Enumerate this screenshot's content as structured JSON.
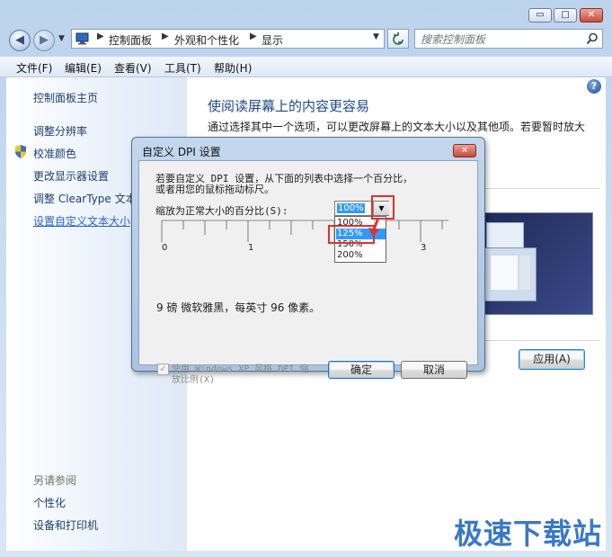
{
  "window": {
    "caption_buttons": {
      "minimize": "▭",
      "maximize": "□",
      "close": "✕"
    }
  },
  "nav": {
    "back_icon": "back-arrow-icon",
    "forward_icon": "forward-arrow-icon",
    "breadcrumb": [
      "控制面板",
      "外观和个性化",
      "显示"
    ],
    "search_placeholder": "搜索控制面板"
  },
  "menu": {
    "items": [
      "文件(F)",
      "编辑(E)",
      "查看(V)",
      "工具(T)",
      "帮助(H)"
    ]
  },
  "sidebar": {
    "home": "控制面板主页",
    "links": [
      "调整分辨率",
      "校准颜色",
      "更改显示器设置",
      "调整 ClearType 文本",
      "设置自定义文本大小"
    ],
    "see_also_title": "另请参阅",
    "see_also": [
      "个性化",
      "设备和打印机"
    ]
  },
  "main": {
    "title": "使阅读屏幕上的内容更容易",
    "description": "通过选择其中一个选项，可以更改屏幕上的文本大小以及其他项。若要暂时放大",
    "apply_button": "应用(A)"
  },
  "dialog": {
    "title": "自定义 DPI 设置",
    "close": "✕",
    "intro_line1": "若要自定义 DPI 设置，从下面的列表中选择一个百分比，",
    "intro_line2": "或者用您的鼠标拖动标尺。",
    "scale_label": "缩放为正常大小的百分比(S):",
    "scale_value": "100%",
    "options": [
      "100%",
      "125%",
      "150%",
      "200%"
    ],
    "highlighted_option": "125%",
    "ruler_labels": [
      "0",
      "1",
      "3"
    ],
    "sample_text": "9 磅 微软雅黑，每英寸 96 像素。",
    "xp_checkbox_line1": "使用 Windows XP 风格 DPI 缩",
    "xp_checkbox_line2": "放比例(X)",
    "xp_checked": true,
    "ok_button": "确定",
    "cancel_button": "取消"
  },
  "watermark": "极速下载站",
  "colors": {
    "link": "#1e3f6e",
    "title_blue": "#1e4a8a",
    "highlight_red": "#e0312d",
    "selection_blue": "#3399ff"
  }
}
